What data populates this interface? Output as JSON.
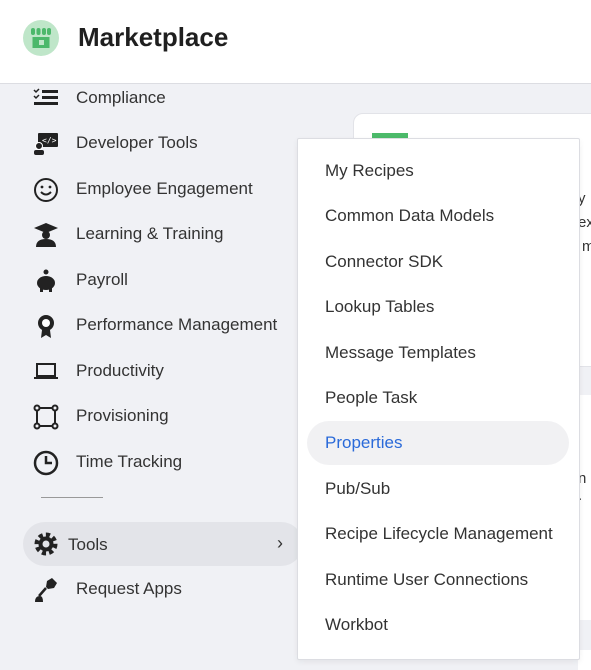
{
  "header": {
    "title": "Marketplace",
    "logo_icon": "storefront-icon",
    "logo_color": "#4cb86b"
  },
  "sidebar": {
    "items": [
      {
        "label": "Compliance",
        "icon": "checklist-icon"
      },
      {
        "label": "Developer Tools",
        "icon": "developer-monitor-icon"
      },
      {
        "label": "Employee Engagement",
        "icon": "smiley-icon"
      },
      {
        "label": "Learning & Training",
        "icon": "graduate-icon"
      },
      {
        "label": "Payroll",
        "icon": "piggy-bank-icon"
      },
      {
        "label": "Performance Management",
        "icon": "award-ribbon-icon"
      },
      {
        "label": "Productivity",
        "icon": "laptop-icon"
      },
      {
        "label": "Provisioning",
        "icon": "nodes-icon"
      },
      {
        "label": "Time Tracking",
        "icon": "clock-icon"
      }
    ],
    "tools": {
      "label": "Tools",
      "icon": "gear-icon",
      "chevron": "›"
    },
    "request_apps": {
      "label": "Request Apps",
      "icon": "pen-icon"
    }
  },
  "tools_menu": {
    "items": [
      "My Recipes",
      "Common Data Models",
      "Connector SDK",
      "Lookup Tables",
      "Message Templates",
      "People Task",
      "Properties",
      "Pub/Sub",
      "Recipe Lifecycle Management",
      "Runtime User Connections",
      "Workbot"
    ],
    "active": "Properties",
    "active_color": "#2a6ad9"
  },
  "background": {
    "fragments": [
      "y",
      "ex",
      "m",
      "n ."
    ]
  }
}
